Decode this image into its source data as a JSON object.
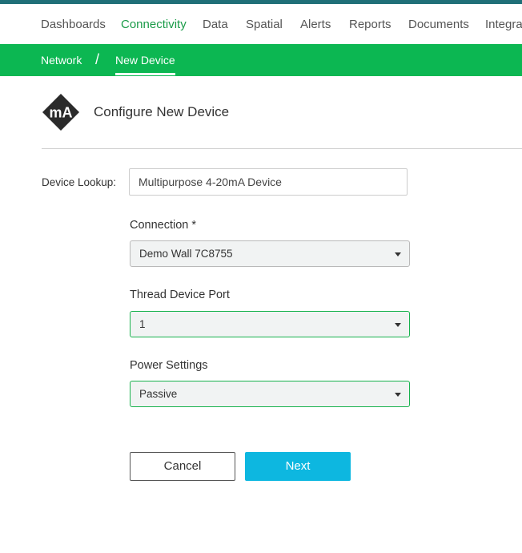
{
  "topnav": {
    "items": [
      {
        "label": "Dashboards",
        "active": false
      },
      {
        "label": "Connectivity",
        "active": true
      },
      {
        "label": "Data",
        "active": false
      },
      {
        "label": "Spatial",
        "active": false
      },
      {
        "label": "Alerts",
        "active": false
      },
      {
        "label": "Reports",
        "active": false
      },
      {
        "label": "Documents",
        "active": false
      },
      {
        "label": "Integrat",
        "active": false
      }
    ]
  },
  "breadcrumb": {
    "parent": "Network",
    "separator": "/",
    "current": "New Device"
  },
  "header": {
    "icon_text": "mA",
    "title": "Configure New Device"
  },
  "form": {
    "lookup_label": "Device Lookup:",
    "lookup_value": "Multipurpose 4-20mA Device",
    "connection_label": "Connection *",
    "connection_value": "Demo Wall 7C8755",
    "port_label": "Thread Device Port",
    "port_value": "1",
    "power_label": "Power Settings",
    "power_value": "Passive"
  },
  "actions": {
    "cancel_label": "Cancel",
    "next_label": "Next"
  },
  "colors": {
    "accent_green": "#0cb752",
    "active_nav_text": "#1a9b48",
    "top_strip": "#1f6f78",
    "next_button": "#0db7e0",
    "valid_border": "#19b24e"
  }
}
